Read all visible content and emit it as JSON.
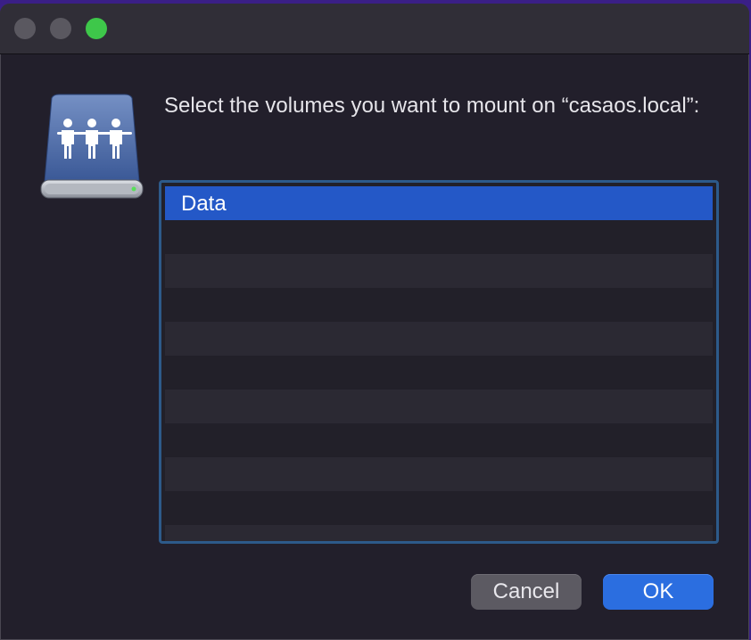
{
  "window": {
    "traffic_lights": [
      "close",
      "minimize",
      "zoom"
    ]
  },
  "icon": {
    "name": "network-server-icon"
  },
  "dialog": {
    "prompt": "Select the volumes you want to mount on “casaos.local”:"
  },
  "volumes": {
    "items": [
      {
        "label": "Data",
        "selected": true
      }
    ]
  },
  "buttons": {
    "cancel_label": "Cancel",
    "ok_label": "OK"
  },
  "colors": {
    "selection": "#2458c7",
    "default_button": "#2b6ee0",
    "zoom_button": "#3ec74a"
  }
}
